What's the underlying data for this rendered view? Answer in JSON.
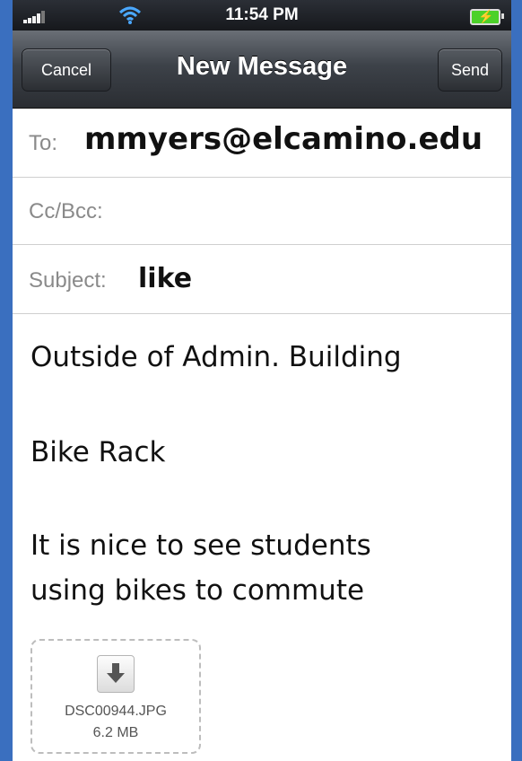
{
  "status_bar": {
    "time": "11:54 PM",
    "icons": [
      "signal-icon",
      "wifi-icon",
      "battery-icon"
    ]
  },
  "navbar": {
    "title": "New Message",
    "cancel_label": "Cancel",
    "send_label": "Send"
  },
  "fields": {
    "to": {
      "label": "To:",
      "value": "mmyers@elcamino.edu"
    },
    "cc_bcc": {
      "label": "Cc/Bcc:",
      "value": ""
    },
    "subject": {
      "label": "Subject:",
      "value": "like"
    }
  },
  "body": {
    "line1": "Outside of Admin. Building",
    "line2": "Bike Rack",
    "line3": "It is nice to see students",
    "line4": "using bikes to commute"
  },
  "attachment": {
    "icon": "download-arrow-icon",
    "filename": "DSC00944.JPG",
    "size": "6.2 MB"
  },
  "colors": {
    "background": "#3a6fbf",
    "navbar": "#3d4249",
    "label_gray": "#8a8a8a"
  }
}
